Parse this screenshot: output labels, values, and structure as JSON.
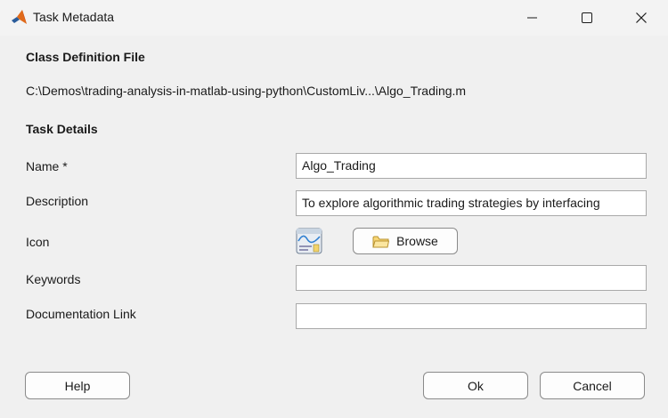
{
  "window": {
    "title": "Task Metadata",
    "icon": "matlab-icon",
    "controls": {
      "minimize": "minimize-icon",
      "maximize": "maximize-icon",
      "close": "close-icon"
    }
  },
  "class_definition": {
    "heading": "Class Definition File",
    "path": "C:\\Demos\\trading-analysis-in-matlab-using-python\\CustomLiv...\\Algo_Trading.m"
  },
  "task_details": {
    "heading": "Task Details",
    "name_label": "Name *",
    "name_value": "Algo_Trading",
    "description_label": "Description",
    "description_value": "To explore algorithmic trading strategies by interfacing",
    "icon_label": "Icon",
    "icon_preview": "chart-document-icon",
    "browse_label": "Browse",
    "browse_icon": "folder-icon",
    "keywords_label": "Keywords",
    "keywords_value": "",
    "doc_link_label": "Documentation Link",
    "doc_link_value": ""
  },
  "buttons": {
    "help": "Help",
    "ok": "Ok",
    "cancel": "Cancel"
  }
}
